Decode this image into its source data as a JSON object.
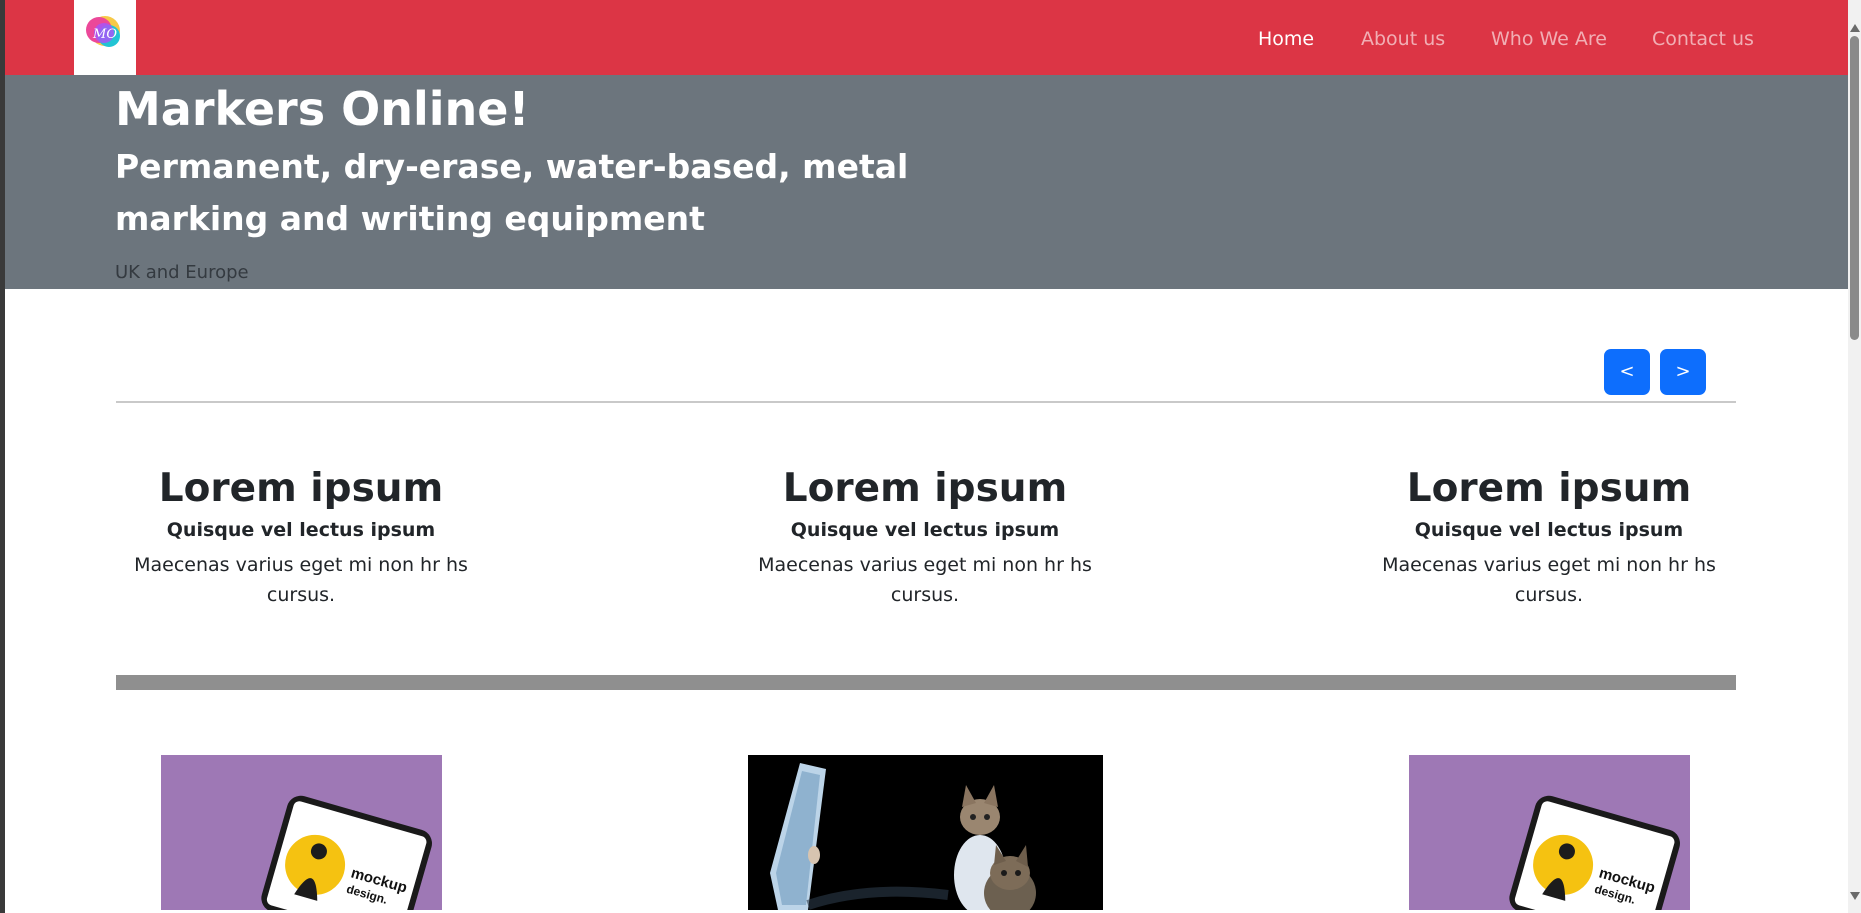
{
  "navbar": {
    "logo_text": "MO",
    "links": [
      {
        "label": "Home",
        "active": true
      },
      {
        "label": "About us",
        "active": false
      },
      {
        "label": "Who We Are",
        "active": false
      },
      {
        "label": "Contact us",
        "active": false
      }
    ]
  },
  "hero": {
    "title": "Markers Online!",
    "subtitle": "Permanent, dry-erase, water-based, metal marking and writing equipment",
    "region": "UK and Europe"
  },
  "carousel": {
    "prev_label": "<",
    "next_label": ">"
  },
  "features": [
    {
      "title": "Lorem ipsum",
      "subtitle": "Quisque vel lectus ipsum",
      "text": "Maecenas varius eget mi non hr hs cursus."
    },
    {
      "title": "Lorem ipsum",
      "subtitle": "Quisque vel lectus ipsum",
      "text": "Maecenas varius eget mi non hr hs cursus."
    },
    {
      "title": "Lorem ipsum",
      "subtitle": "Quisque vel lectus ipsum",
      "text": "Maecenas varius eget mi non hr hs cursus."
    }
  ],
  "gallery": [
    {
      "image": "tablet-mockup",
      "text_line1": "mockup",
      "text_line2": "design."
    },
    {
      "image": "kittens-with-mirror"
    },
    {
      "image": "tablet-mockup",
      "text_line1": "mockup",
      "text_line2": "design."
    }
  ],
  "colors": {
    "navbar_bg": "#dc3545",
    "hero_bg": "#6c757d",
    "button_primary": "#0d6efd",
    "mockup_bg": "#9e78b5"
  }
}
